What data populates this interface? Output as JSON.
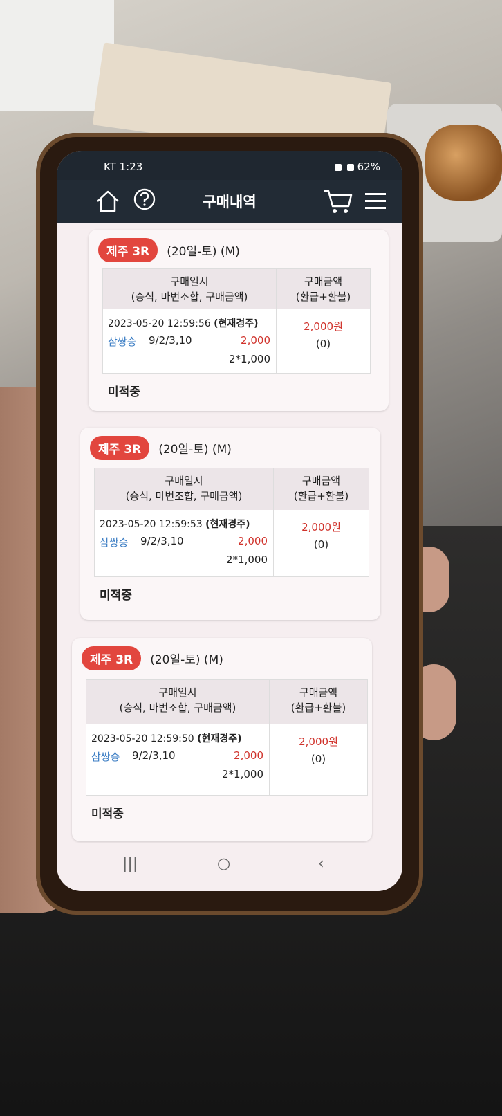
{
  "status_bar": {
    "carrier_time": "KT 1:23",
    "battery": "62%"
  },
  "app_bar": {
    "title": "구매내역",
    "icons": [
      "home-icon",
      "help-icon",
      "cart-icon",
      "menu-icon"
    ]
  },
  "table_headers": {
    "left_line1": "구매일시",
    "left_line2": "(승식, 마번조합, 구매금액)",
    "right_line1": "구매금액",
    "right_line2": "(환급+환불)"
  },
  "purchases": [
    {
      "race_badge": "제주 3R",
      "race_info": "(20일-토) (M)",
      "datetime": "2023-05-20 12:59:56",
      "datetime_note": "(현재경주)",
      "bet_type": "삼쌍승",
      "combination": "9/2/3,10",
      "bet_amount": "2,000",
      "multiplier": "2*1,000",
      "purchase_amount": "2,000원",
      "refund": "(0)",
      "status": "미적중"
    },
    {
      "race_badge": "제주 3R",
      "race_info": "(20일-토) (M)",
      "datetime": "2023-05-20 12:59:53",
      "datetime_note": "(현재경주)",
      "bet_type": "삼쌍승",
      "combination": "9/2/3,10",
      "bet_amount": "2,000",
      "multiplier": "2*1,000",
      "purchase_amount": "2,000원",
      "refund": "(0)",
      "status": "미적중"
    },
    {
      "race_badge": "제주 3R",
      "race_info": "(20일-토) (M)",
      "datetime": "2023-05-20 12:59:50",
      "datetime_note": "(현재경주)",
      "bet_type": "삼쌍승",
      "combination": "9/2/3,10",
      "bet_amount": "2,000",
      "multiplier": "2*1,000",
      "purchase_amount": "2,000원",
      "refund": "(0)",
      "status": "미적중"
    }
  ],
  "nav_bar": {
    "recent": "|||",
    "home": "○",
    "back": "‹"
  },
  "colors": {
    "badge": "#e2463e",
    "bet_type": "#3b7dc4",
    "amount_red": "#d0322b",
    "app_bar": "#222b35"
  }
}
